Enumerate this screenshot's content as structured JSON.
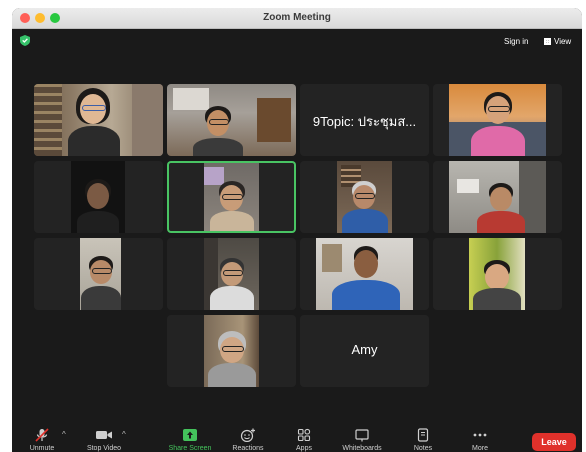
{
  "window": {
    "title": "Zoom Meeting"
  },
  "topbar": {
    "sign_in": "Sign in",
    "view": "View"
  },
  "participants": [
    {
      "label": ""
    },
    {
      "label": ""
    },
    {
      "label": "9Topic: ประชุมส..."
    },
    {
      "label": ""
    },
    {
      "label": ""
    },
    {
      "label": ""
    },
    {
      "label": ""
    },
    {
      "label": ""
    },
    {
      "label": ""
    },
    {
      "label": ""
    },
    {
      "label": ""
    },
    {
      "label": ""
    },
    {
      "label": ""
    },
    {
      "label": "Amy"
    }
  ],
  "toolbar": {
    "unmute": "Unmute",
    "stop_video": "Stop Video",
    "share_screen": "Share Screen",
    "reactions": "Reactions",
    "apps": "Apps",
    "whiteboards": "Whiteboards",
    "notes": "Notes",
    "more": "More",
    "leave": "Leave"
  },
  "colors": {
    "active_speaker": "#49c463",
    "leave": "#e0312b",
    "share": "#44c35c"
  }
}
